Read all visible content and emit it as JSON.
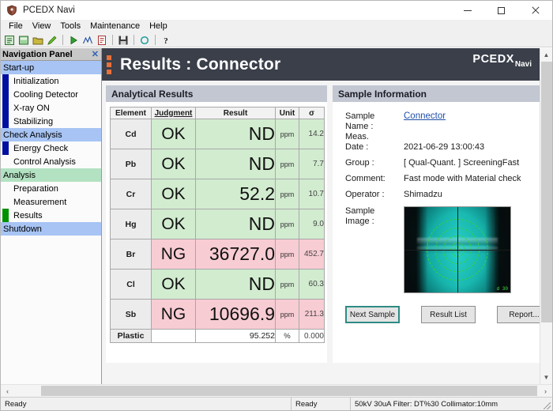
{
  "window": {
    "title": "PCEDX Navi",
    "app_icon": "shield-icon",
    "minimize_label": "−",
    "maximize_label": "□",
    "close_label": "✕"
  },
  "menubar": {
    "items": [
      {
        "label": "File"
      },
      {
        "label": "View"
      },
      {
        "label": "Tools"
      },
      {
        "label": "Maintenance"
      },
      {
        "label": "Help"
      }
    ]
  },
  "toolbar": {
    "buttons": [
      {
        "name": "new-document-icon",
        "glyph": "▣",
        "color": "#2f9e44"
      },
      {
        "name": "open-sample-icon",
        "glyph": "▤",
        "color": "#3b8c3b"
      },
      {
        "name": "folder-icon",
        "glyph": "▰",
        "color": "#6f8a2f"
      },
      {
        "name": "edit-pencil-icon",
        "glyph": "✎",
        "color": "#4caf2f"
      },
      {
        "name": "run-icon",
        "glyph": "▶",
        "color": "#2f9e44"
      },
      {
        "name": "spectrum-icon",
        "glyph": "⤳",
        "color": "#2b5fa8"
      },
      {
        "name": "report-icon",
        "glyph": "▧",
        "color": "#b03030"
      },
      {
        "name": "save-icon",
        "glyph": "▬",
        "color": "#303030"
      },
      {
        "name": "refresh-icon",
        "glyph": "○",
        "color": "#1f9b9b"
      },
      {
        "name": "help-icon",
        "glyph": "?",
        "color": "#1a1a1a"
      }
    ]
  },
  "navigation": {
    "header": "Navigation Panel",
    "close_label": "✕",
    "items": [
      {
        "label": "Start-up",
        "type": "group",
        "style": "blue"
      },
      {
        "label": "Initialization",
        "type": "child",
        "bar": "navy"
      },
      {
        "label": "Cooling Detector",
        "type": "child",
        "bar": "navy"
      },
      {
        "label": "X-ray ON",
        "type": "child",
        "bar": "navy"
      },
      {
        "label": "Stabilizing",
        "type": "child",
        "bar": "navy"
      },
      {
        "label": "Check Analysis",
        "type": "group",
        "style": "blue"
      },
      {
        "label": "Energy Check",
        "type": "child",
        "bar": "navy"
      },
      {
        "label": "Control Analysis",
        "type": "child",
        "bar": "none"
      },
      {
        "label": "Analysis",
        "type": "group",
        "style": "green"
      },
      {
        "label": "Preparation",
        "type": "child",
        "bar": "none"
      },
      {
        "label": "Measurement",
        "type": "child",
        "bar": "none"
      },
      {
        "label": "Results",
        "type": "child",
        "bar": "green"
      },
      {
        "label": "Shutdown",
        "type": "group",
        "style": "blue"
      }
    ]
  },
  "page": {
    "title": "Results : Connector",
    "brand_main": "PCEDX",
    "brand_sub": "Navi"
  },
  "analytical_results": {
    "panel_title": "Analytical Results",
    "columns": [
      "Element",
      "Judgment",
      "Result",
      "Unit",
      "σ"
    ],
    "rows": [
      {
        "element": "Cd",
        "judgment": "OK",
        "result": "ND",
        "unit": "ppm",
        "sigma": "14.2",
        "status": "ok"
      },
      {
        "element": "Pb",
        "judgment": "OK",
        "result": "ND",
        "unit": "ppm",
        "sigma": "7.7",
        "status": "ok"
      },
      {
        "element": "Cr",
        "judgment": "OK",
        "result": "52.2",
        "unit": "ppm",
        "sigma": "10.7",
        "status": "ok"
      },
      {
        "element": "Hg",
        "judgment": "OK",
        "result": "ND",
        "unit": "ppm",
        "sigma": "9.0",
        "status": "ok"
      },
      {
        "element": "Br",
        "judgment": "NG",
        "result": "36727.0",
        "unit": "ppm",
        "sigma": "452.7",
        "status": "ng"
      },
      {
        "element": "Cl",
        "judgment": "OK",
        "result": "ND",
        "unit": "ppm",
        "sigma": "60.3",
        "status": "ok"
      },
      {
        "element": "Sb",
        "judgment": "NG",
        "result": "10696.9",
        "unit": "ppm",
        "sigma": "211.3",
        "status": "ng"
      }
    ],
    "summary_row": {
      "element": "Plastic",
      "judgment": "",
      "result": "95.252",
      "unit": "%",
      "sigma": "0.000"
    }
  },
  "sample_information": {
    "panel_title": "Sample Information",
    "fields": [
      {
        "label": "Sample\nName :",
        "value": "Connector",
        "is_link": true
      },
      {
        "label": "Meas.\nDate :",
        "value": "2021-06-29 13:00:43",
        "is_link": false
      },
      {
        "label": "Group :",
        "value": "[ Qual-Quant. ] ScreeningFast",
        "is_link": false
      },
      {
        "label": "Comment:",
        "value": "Fast mode with Material check",
        "is_link": false
      },
      {
        "label": "Operator :",
        "value": "Shimadzu",
        "is_link": false
      }
    ],
    "sample_name_label_l1": "Sample",
    "sample_name_label_l2": "Name :",
    "sample_name_value": "Connector",
    "meas_date_label_l1": "Meas.",
    "meas_date_label_l2": "Date :",
    "meas_date_value": "2021-06-29 13:00:43",
    "group_label": "Group :",
    "group_value": "[ Qual-Quant. ] ScreeningFast",
    "comment_label": "Comment:",
    "comment_value": "Fast mode with Material check",
    "operator_label": "Operator :",
    "operator_value": "Shimadzu",
    "image_label_l1": "Sample",
    "image_label_l2": "Image :",
    "image_stamp": "d 30",
    "buttons": [
      {
        "label": "Next Sample",
        "focused": true
      },
      {
        "label": "Result List",
        "focused": false
      },
      {
        "label": "Report...",
        "focused": false
      }
    ]
  },
  "scrollbars": {
    "v_up": "▲",
    "v_down": "▼",
    "h_left": "‹",
    "h_right": "›"
  },
  "statusbar": {
    "left": "Ready",
    "middle": "Ready",
    "right": "50kV  30uA  Filter: DT%30 Collimator:10mm"
  },
  "colors": {
    "header_bg": "#3a3f4a",
    "accent_orange": "#e8703a",
    "ok_green": "#d2ecd0",
    "ng_pink": "#f8ccd3",
    "group_blue": "#a7c4f4",
    "group_green": "#b3e2c2",
    "panel_title_bg": "#c2c7d2",
    "focus_teal": "#2e8b84",
    "link_blue": "#1f4fa8"
  }
}
